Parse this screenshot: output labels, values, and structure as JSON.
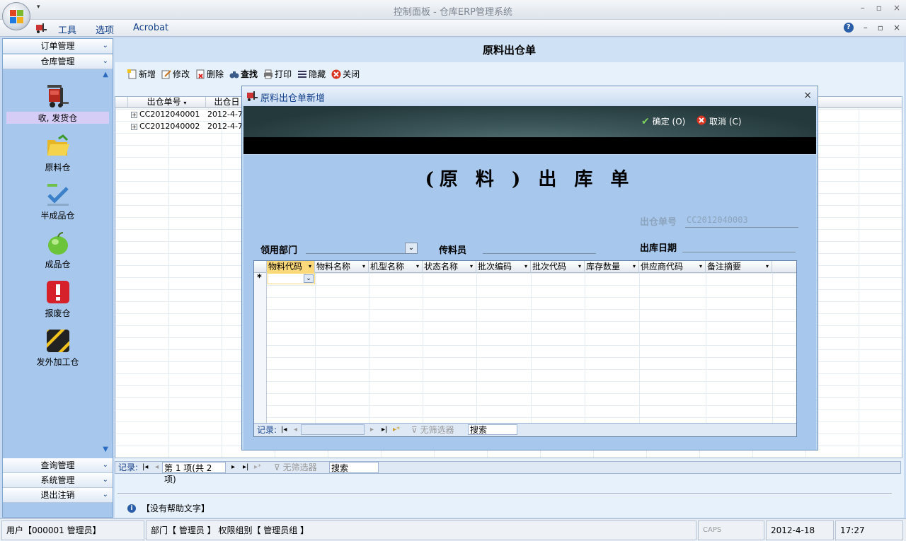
{
  "window": {
    "title": "控制面板 - 仓库ERP管理系统",
    "controls": {
      "minimize": "–",
      "restore": "▫",
      "close": "×"
    }
  },
  "menubar": {
    "items": [
      "工具",
      "选项",
      "Acrobat"
    ],
    "right_controls": [
      "?",
      "–",
      "▫",
      "×"
    ]
  },
  "sidebar": {
    "top_groups": [
      {
        "label": "订单管理",
        "chevron": "⌄"
      },
      {
        "label": "仓库管理",
        "chevron": "⌃"
      }
    ],
    "items": [
      {
        "label": "收, 发货仓",
        "icon": "forklift-icon",
        "selected": true
      },
      {
        "label": "原料仓",
        "icon": "folder-icon",
        "selected": false
      },
      {
        "label": "半成品仓",
        "icon": "check-icon",
        "selected": false
      },
      {
        "label": "成品仓",
        "icon": "apple-icon",
        "selected": false
      },
      {
        "label": "报废仓",
        "icon": "warning-icon",
        "selected": false
      },
      {
        "label": "发外加工仓",
        "icon": "hazard-stripe-icon",
        "selected": false
      }
    ],
    "bottom_groups": [
      {
        "label": "查询管理",
        "chevron": "⌄"
      },
      {
        "label": "系统管理",
        "chevron": "⌄"
      },
      {
        "label": "退出注销",
        "chevron": "⌄"
      }
    ]
  },
  "main": {
    "title": "原料出仓单",
    "toolbar": [
      "新增",
      "修改",
      "删除",
      "查找",
      "打印",
      "隐藏",
      "关闭"
    ],
    "grid": {
      "columns": [
        "出仓单号",
        "出仓日"
      ],
      "rows": [
        {
          "no": "CC2012040001",
          "date": "2012-4-7"
        },
        {
          "no": "CC2012040002",
          "date": "2012-4-7"
        }
      ]
    },
    "nav": {
      "label": "记录:",
      "position": "第 1 项(共 2 项)",
      "filter": "无筛选器",
      "search": "搜索"
    },
    "help_text": "【没有帮助文字】"
  },
  "dialog": {
    "title": "原料出仓单新增",
    "ok_label": "确定 (O)",
    "cancel_label": "取消 (C)",
    "doc_title": "(原 料 ) 出 库 单",
    "order_no_label": "出仓单号",
    "order_no_value": "CC2012040003",
    "dept_label": "领用部门",
    "courier_label": "传料员",
    "date_label": "出库日期",
    "columns": [
      "物料代码",
      "物料名称",
      "机型名称",
      "状态名称",
      "批次编码",
      "批次代码",
      "库存数量",
      "供应商代码",
      "备注摘要"
    ],
    "new_row_marker": "*",
    "nav": {
      "label": "记录:",
      "filter": "无筛选器",
      "search": "搜索"
    }
  },
  "statusbar": {
    "user": "用户【000001 管理员】",
    "dept": "部门【 管理员 】 权限组别【 管理员组 】",
    "caps": "CAPS",
    "date": "2012-4-18",
    "time": "17:27"
  }
}
